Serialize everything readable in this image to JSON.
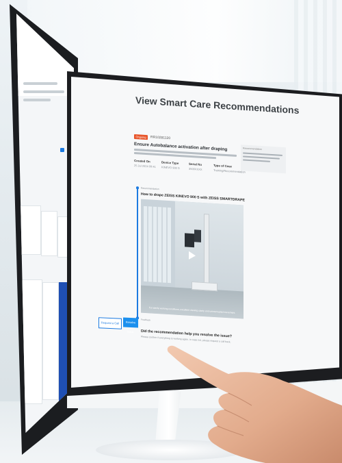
{
  "screen": {
    "page_title": "View Smart Care Recommendations",
    "issue": {
      "badge": "Ongoing",
      "ticket_id": "RR10281120",
      "title": "Ensure Autobalance activation after draping"
    },
    "meta": [
      {
        "label": "Created On",
        "value": "25 Jul 2024 09:41"
      },
      {
        "label": "Device Type",
        "value": "KINEVO 900 S"
      },
      {
        "label": "Serial No",
        "value": "3500XXXX"
      },
      {
        "label": "Type of Case",
        "value": "Training/Recommendation"
      }
    ],
    "side_note_title": "Recommendation",
    "recommendation": {
      "label": "Recommendation",
      "title": "How to drape ZEISS KINEVO 900 S with ZEISS SMARTDRAPE",
      "video_caption": "For sterile working conditions, excellent viewing clarity and uninterrupted movement."
    },
    "feedback": {
      "label": "Feedback",
      "question": "Did the recommendation help you resolve the issue?",
      "sub": "Please confirm if everything is working again. In case not, please request a call back."
    },
    "buttons": {
      "secondary": "Request a Call",
      "primary": "Resolve Issue"
    }
  },
  "colors": {
    "accent": "#1c90ee",
    "badge": "#e8552a",
    "bezel": "#1c1d20"
  }
}
